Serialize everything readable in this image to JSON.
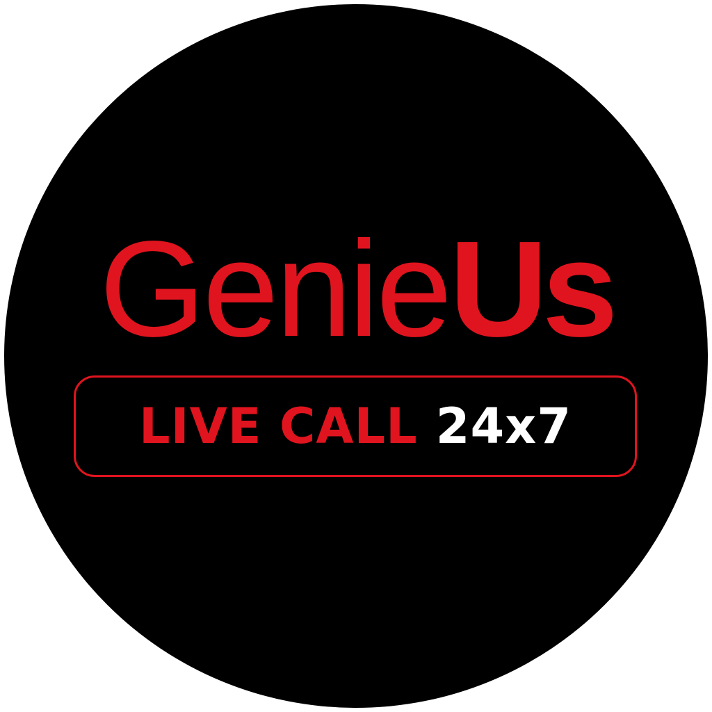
{
  "logo": {
    "word_light": "Genie",
    "word_bold": "Us"
  },
  "tagline": {
    "primary": "LIVE CALL",
    "secondary": "24x7"
  },
  "colors": {
    "background": "#ffffff",
    "circle": "#000000",
    "brand_red": "#e0141e",
    "white": "#ffffff"
  }
}
